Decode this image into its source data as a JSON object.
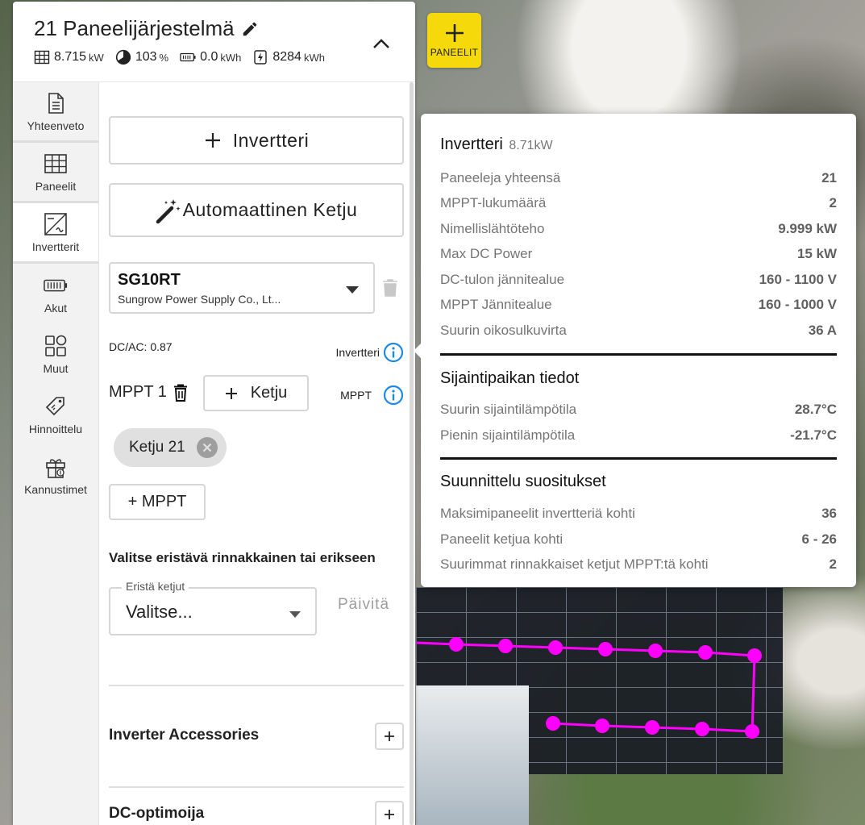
{
  "header": {
    "title": "21 Paneelijärjestelmä",
    "stats": [
      {
        "icon": "panel-grid-icon",
        "value": "8.715",
        "unit": "kW"
      },
      {
        "icon": "pie-progress-icon",
        "value": "103",
        "unit": "%"
      },
      {
        "icon": "battery-icon",
        "value": "0.0",
        "unit": "kWh"
      },
      {
        "icon": "energy-bolt-icon",
        "value": "8284",
        "unit": "kWh"
      }
    ]
  },
  "nav": {
    "items": [
      {
        "label": "Yhteenveto",
        "icon": "document-icon"
      },
      {
        "label": "Paneelit",
        "icon": "panel-grid-icon"
      },
      {
        "label": "Invertterit",
        "icon": "inverter-icon",
        "active": true
      },
      {
        "label": "Akut",
        "icon": "battery-icon"
      },
      {
        "label": "Muut",
        "icon": "widgets-icon"
      },
      {
        "label": "Hinnoittelu",
        "icon": "price-tag-icon"
      },
      {
        "label": "Kannustimet",
        "icon": "gift-icon"
      }
    ]
  },
  "content": {
    "add_inverter_label": "Invertteri",
    "auto_chain_label": "Automaattinen Ketju",
    "inverter_model": "SG10RT",
    "inverter_maker": "Sungrow Power Supply Co., Lt...",
    "dc_ac": "DC/AC: 0.87",
    "inverter_info_label": "Invertteri",
    "mppt_title": "MPPT 1",
    "add_chain_label": "Ketju",
    "mppt_info_label": "MPPT",
    "chain_chip": "Ketju 21",
    "add_mppt_label": "+ MPPT",
    "isolate_title": "Valitse eristävä rinnakkainen tai erikseen",
    "isolate_legend": "Eristä ketjut",
    "isolate_value": "Valitse...",
    "update_label": "Päivitä",
    "accessories_title": "Inverter Accessories",
    "optimizer_title": "DC-optimoija"
  },
  "panels_button": {
    "label": "PANEELIT"
  },
  "popover": {
    "title": "Invertteri",
    "title_sub": "8.71kW",
    "specs": [
      {
        "k": "Paneeleja yhteensä",
        "v": "21"
      },
      {
        "k": "MPPT-lukumäärä",
        "v": "2"
      },
      {
        "k": "Nimellislähtöteho",
        "v": "9.999 kW"
      },
      {
        "k": "Max DC Power",
        "v": "15 kW"
      },
      {
        "k": "DC-tulon jännitealue",
        "v": "160 - 1100 V"
      },
      {
        "k": "MPPT Jännitealue",
        "v": "160 - 1000 V"
      },
      {
        "k": "Suurin oikosulkuvirta",
        "v": "36 A"
      }
    ],
    "site_title": "Sijaintipaikan tiedot",
    "site": [
      {
        "k": "Suurin sijaintilämpötila",
        "v": "28.7°C"
      },
      {
        "k": "Pienin sijaintilämpötila",
        "v": "-21.7°C"
      }
    ],
    "design_title": "Suunnittelu suositukset",
    "design": [
      {
        "k": "Maksimipaneelit invertteriä kohti",
        "v": "36"
      },
      {
        "k": "Paneelit ketjua kohti",
        "v": "6 - 26"
      },
      {
        "k": "Suurimmat rinnakkaiset ketjut MPPT:tä kohti",
        "v": "2"
      }
    ]
  },
  "colors": {
    "accent_yellow": "#f5d90a",
    "info_blue": "#1e88e5",
    "string_magenta": "#ff00ff"
  }
}
